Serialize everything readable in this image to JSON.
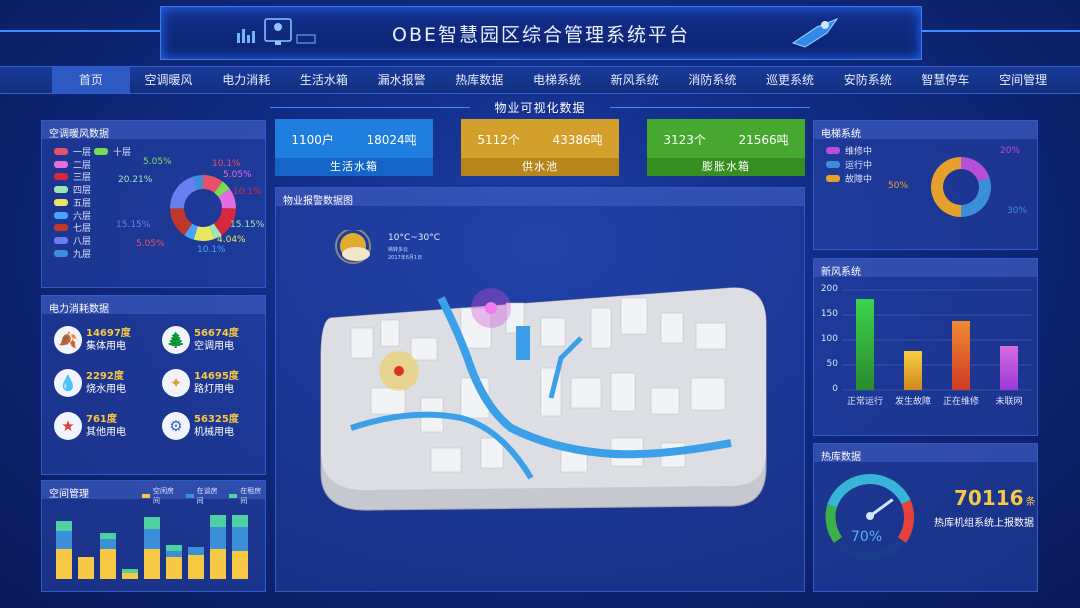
{
  "header": {
    "title": "OBE智慧园区综合管理系统平台"
  },
  "nav": [
    "首页",
    "空调暖风",
    "电力消耗",
    "生活水箱",
    "漏水报警",
    "热库数据",
    "电梯系统",
    "新风系统",
    "消防系统",
    "巡更系统",
    "安防系统",
    "智慧停车",
    "空间管理"
  ],
  "section_title": "物业可视化数据",
  "hvac": {
    "title": "空调暖风数据",
    "legend": [
      {
        "label": "一层",
        "color": "#e8506a"
      },
      {
        "label": "十层",
        "color": "#7ed957"
      },
      {
        "label": "二层",
        "color": "#e46be0"
      },
      {
        "label": "三层",
        "color": "#d8283e"
      },
      {
        "label": "四层",
        "color": "#9ee6b8"
      },
      {
        "label": "五层",
        "color": "#e8e860"
      },
      {
        "label": "六层",
        "color": "#47a3ff"
      },
      {
        "label": "七层",
        "color": "#c0382c"
      },
      {
        "label": "八层",
        "color": "#6a7ef0"
      },
      {
        "label": "九层",
        "color": "#3b8fd8"
      }
    ],
    "donut_values": [
      10.1,
      5.05,
      10.1,
      15.15,
      4.04,
      10.1,
      5.05,
      15.15,
      20.21,
      5.05
    ],
    "labels": {
      "l1": "5.05%",
      "l2": "20.21%",
      "l3": "15.15%",
      "l4": "5.05%",
      "r1": "10.1%",
      "r2": "5.05%",
      "r3": "10.1%",
      "r4": "15.15%",
      "r5": "4.04%",
      "r6": "10.1%"
    }
  },
  "power": {
    "title": "电力消耗数据",
    "items": [
      {
        "value": "14697度",
        "label": "集体用电",
        "icon": "leaf-icon",
        "glyph": "🍂",
        "color": "#f6c844"
      },
      {
        "value": "56674度",
        "label": "空调用电",
        "icon": "tree-icon",
        "glyph": "🌲",
        "color": "#3fae4a"
      },
      {
        "value": "2292度",
        "label": "烧水用电",
        "icon": "water-drop-icon",
        "glyph": "💧",
        "color": "#2c8cd8"
      },
      {
        "value": "14695度",
        "label": "路灯用电",
        "icon": "lamp-icon",
        "glyph": "✦",
        "color": "#e0a030"
      },
      {
        "value": "761度",
        "label": "其他用电",
        "icon": "star-icon",
        "glyph": "★",
        "color": "#e0403a"
      },
      {
        "value": "56325度",
        "label": "机械用电",
        "icon": "gear-icon",
        "glyph": "⚙",
        "color": "#3a5fc8"
      }
    ]
  },
  "space": {
    "title": "空间管理",
    "legend": [
      {
        "label": "空闲房间",
        "color": "#f6c844"
      },
      {
        "label": "在谈房间",
        "color": "#3b8fd8"
      },
      {
        "label": "在租房间",
        "color": "#4fd0a0"
      }
    ]
  },
  "cards": [
    {
      "v1": "1100户",
      "v2": "18024吨",
      "label": "生活水箱",
      "color": "#1f7fe0",
      "foot": "#1565c8"
    },
    {
      "v1": "5112个",
      "v2": "43386吨",
      "label": "供水池",
      "color": "#d3a02c",
      "foot": "#b8851c"
    },
    {
      "v1": "3123个",
      "v2": "21566吨",
      "label": "膨胀水箱",
      "color": "#46a82e",
      "foot": "#368e20"
    }
  ],
  "alarm_map": {
    "title": "物业报警数据图",
    "weather": {
      "temp": "10°C~30°C",
      "desc": "晴转多云",
      "date": "2017年6月1日"
    }
  },
  "elevator": {
    "title": "电梯系统",
    "legend": [
      {
        "label": "维修中",
        "color": "#b84fd8"
      },
      {
        "label": "运行中",
        "color": "#3b8fd8"
      },
      {
        "label": "故障中",
        "color": "#e6a02c"
      }
    ],
    "values": [
      20,
      30,
      50
    ],
    "labels": {
      "a": "20%",
      "b": "30%",
      "c": "50%"
    }
  },
  "fresh_air": {
    "title": "新风系统",
    "chart_data": {
      "type": "bar",
      "categories": [
        "正常运行",
        "发生故障",
        "正在维修",
        "未联网"
      ],
      "values": [
        182,
        78,
        138,
        88
      ],
      "ylim": [
        0,
        200
      ],
      "yticks": [
        "200",
        "150",
        "100",
        "50",
        "0"
      ]
    }
  },
  "heat": {
    "title": "热库数据",
    "value": "70116",
    "unit": "条",
    "label": "热库机组系统上报数据",
    "gauge_percent": "70%",
    "gauge_level": 0.7
  }
}
